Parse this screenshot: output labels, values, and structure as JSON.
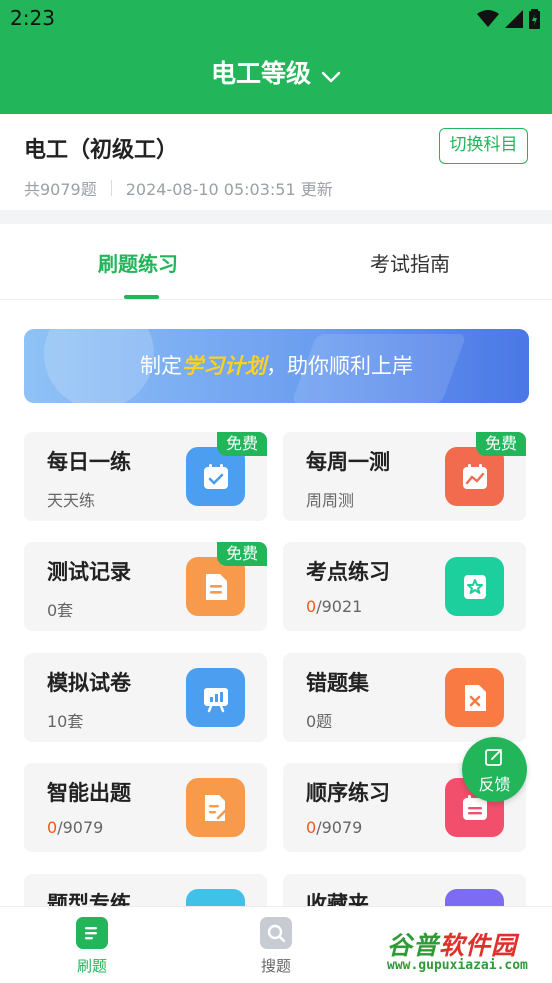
{
  "status_bar": {
    "time": "2:23"
  },
  "header": {
    "title": "电工等级"
  },
  "subject": {
    "name": "电工（初级工）",
    "switch_label": "切换科目",
    "count": "共9079题",
    "updated": "2024-08-10 05:03:51 更新"
  },
  "tabs": [
    {
      "label": "刷题练习",
      "active": true
    },
    {
      "label": "考试指南",
      "active": false
    }
  ],
  "banner": {
    "prefix": "制定",
    "highlight": "学习计划",
    "suffix": "，助你顺利上岸"
  },
  "cards": [
    {
      "title": "每日一练",
      "sub": "天天练",
      "badge": "免费",
      "icon": "calendar-check-icon",
      "color": "#4c9ff0"
    },
    {
      "title": "每周一测",
      "sub": "周周测",
      "badge": "免费",
      "icon": "calendar-chart-icon",
      "color": "#f26b4f"
    },
    {
      "title": "测试记录",
      "sub": "0套",
      "badge": "免费",
      "icon": "document-icon",
      "color": "#f79a4c"
    },
    {
      "title": "考点练习",
      "done": "0",
      "total": "/9021",
      "icon": "star-frame-icon",
      "color": "#1ccf9c"
    },
    {
      "title": "模拟试卷",
      "sub": "10套",
      "icon": "presentation-icon",
      "color": "#4c9ff0"
    },
    {
      "title": "错题集",
      "sub": "0题",
      "icon": "wrong-note-icon",
      "color": "#f97b43"
    },
    {
      "title": "智能出题",
      "done": "0",
      "total": "/9079",
      "icon": "edit-doc-icon",
      "color": "#f79a4c"
    },
    {
      "title": "顺序练习",
      "done": "0",
      "total": "/9079",
      "icon": "list-calendar-icon",
      "color": "#f24f6c"
    },
    {
      "title": "题型专练",
      "icon": "category-icon",
      "color": "#3fc1e8"
    },
    {
      "title": "收藏夹",
      "icon": "bookmark-icon",
      "color": "#7c6cf2"
    }
  ],
  "feedback": {
    "label": "反馈"
  },
  "bottom_nav": [
    {
      "label": "刷题",
      "active": true,
      "icon": "practice-icon"
    },
    {
      "label": "搜题",
      "active": false,
      "icon": "search-question-icon"
    }
  ],
  "watermark": {
    "name_a": "谷普",
    "name_b": "软件园",
    "url": "www.gupuxiazai.com"
  },
  "colors": {
    "brand": "#22b55a",
    "highlight": "#ffd21f",
    "progress_done": "#f05a1a"
  }
}
